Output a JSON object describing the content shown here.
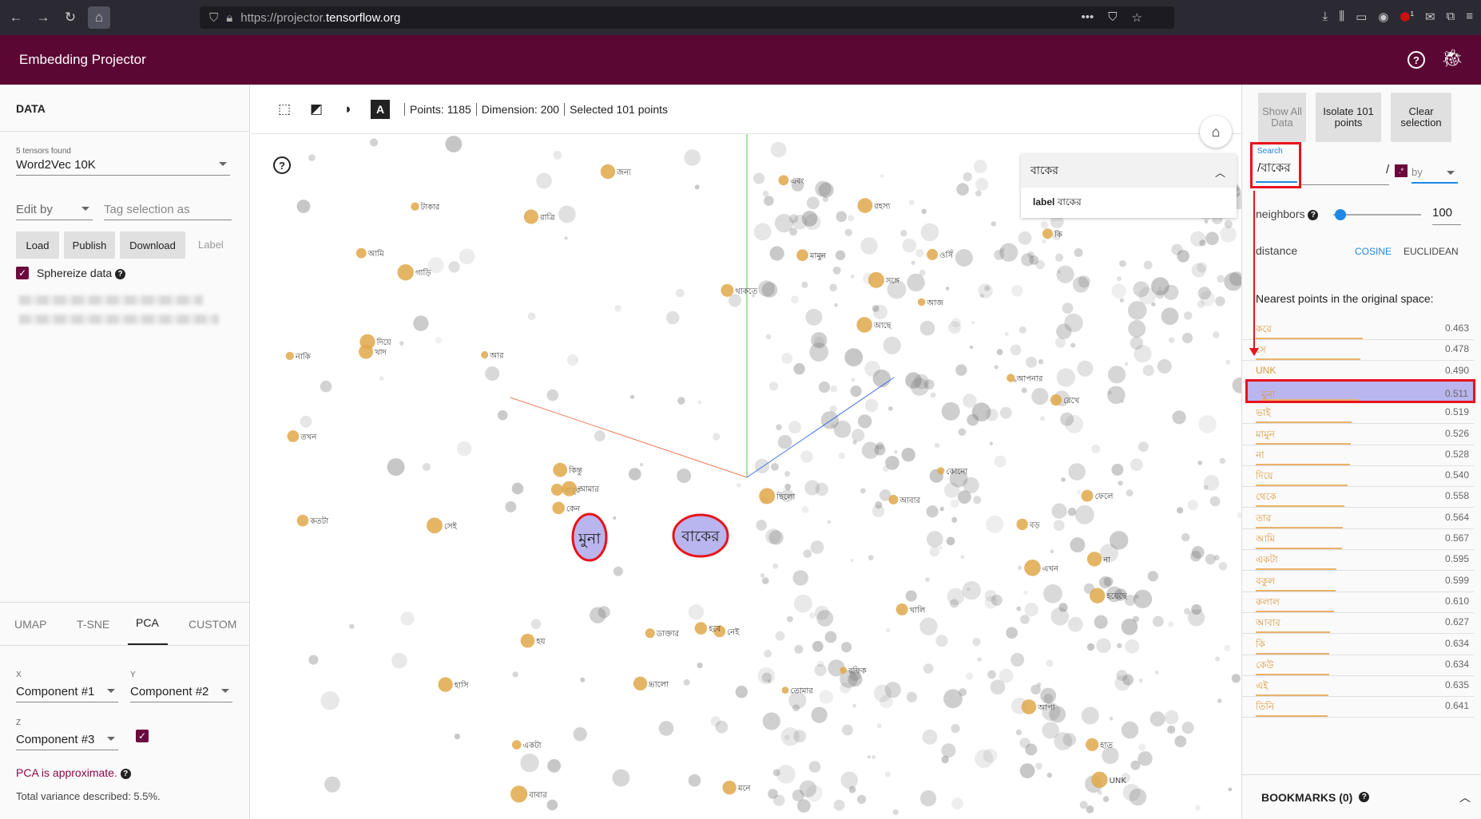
{
  "browser": {
    "url_prefix": "https://projector.",
    "url_domain": "tensorflow.org",
    "badge": "1"
  },
  "app": {
    "title": "Embedding Projector"
  },
  "left": {
    "section_title": "DATA",
    "tensors_found": "5 tensors found",
    "tensor_selected": "Word2Vec 10K",
    "edit_by": "Edit by",
    "tag_placeholder": "Tag selection as",
    "load": "Load",
    "publish": "Publish",
    "download": "Download",
    "label": "Label",
    "sphereize": "Sphereize data",
    "tabs": [
      "UMAP",
      "T-SNE",
      "PCA",
      "CUSTOM"
    ],
    "x_label": "X",
    "y_label": "Y",
    "z_label": "Z",
    "x_value": "Component #1",
    "y_value": "Component #2",
    "z_value": "Component #3",
    "pca_note": "PCA is approximate.",
    "variance": "Total variance described: 5.5%."
  },
  "toolbar": {
    "points": "Points: 1185",
    "dimension": "Dimension: 200",
    "selected": "Selected 101 points"
  },
  "viz": {
    "home_icon": "home-icon",
    "selected_label_1": "মুনা",
    "selected_label_2": "বাকের",
    "info_title": "বাকের",
    "info_key": "label",
    "info_value": "বাকের",
    "word_labels": [
      "কিন্তু",
      "নেই",
      "আর",
      "এখন",
      "কি",
      "সঙ্গে",
      "আছে",
      "হয়",
      "তো",
      "না",
      "আপা",
      "আমি",
      "UNK",
      "হয়েছে",
      "হবে",
      "ফেলে",
      "কোনো",
      "জন্য",
      "সেই",
      "ছিলো",
      "নাকি",
      "আপনার",
      "এবং",
      "তোমার",
      "রাত্রি",
      "দিয়ে",
      "ভালো",
      "রহস্য",
      "বাবুর",
      "আবার",
      "কেন",
      "মনে",
      "আজ",
      "ডাক্তার",
      "হাত",
      "ওসি",
      "একটা",
      "বড়",
      "কতটা",
      "খাদ",
      "থাকতে",
      "খালি",
      "গাড়ি",
      "টাকার",
      "হাসি",
      "রফিক",
      "তখন",
      "মামুন",
      "রেখে",
      "আমার",
      "বাবার"
    ]
  },
  "right": {
    "show_all": "Show All Data",
    "isolate": "Isolate 101 points",
    "clear": "Clear selection",
    "search_label": "Search",
    "search_value": "/বাকের",
    "regex_sep": "/",
    "regex_mark": ".*",
    "by": "by",
    "neighbors_label": "neighbors",
    "neighbors_value": "100",
    "distance_label": "distance",
    "cosine": "COSINE",
    "euclidean": "EUCLIDEAN",
    "nearest_title": "Nearest points in the original space:",
    "nearest": [
      {
        "label": "করে",
        "value": "0.463"
      },
      {
        "label": "সে",
        "value": "0.478"
      },
      {
        "label": "UNK",
        "value": "0.490"
      },
      {
        "label": "মুনা",
        "value": "0.511"
      },
      {
        "label": "ভাই",
        "value": "0.519"
      },
      {
        "label": "মামুন",
        "value": "0.526"
      },
      {
        "label": "না",
        "value": "0.528"
      },
      {
        "label": "দিয়ে",
        "value": "0.540"
      },
      {
        "label": "থেকে",
        "value": "0.558"
      },
      {
        "label": "তার",
        "value": "0.564"
      },
      {
        "label": "আমি",
        "value": "0.567"
      },
      {
        "label": "একটা",
        "value": "0.595"
      },
      {
        "label": "বকুল",
        "value": "0.599"
      },
      {
        "label": "কলাল",
        "value": "0.610"
      },
      {
        "label": "আবার",
        "value": "0.627"
      },
      {
        "label": "কি",
        "value": "0.634"
      },
      {
        "label": "কেউ",
        "value": "0.634"
      },
      {
        "label": "এই",
        "value": "0.635"
      },
      {
        "label": "তিনি",
        "value": "0.641"
      }
    ],
    "bookmarks": "BOOKMARKS (0)"
  },
  "colors": {
    "brand": "#5b0734",
    "accent_blue": "#1e88e5",
    "highlight_red": "#e8131c",
    "selection_fill": "#b9b5ee",
    "point_orange": "#e0a84b"
  }
}
